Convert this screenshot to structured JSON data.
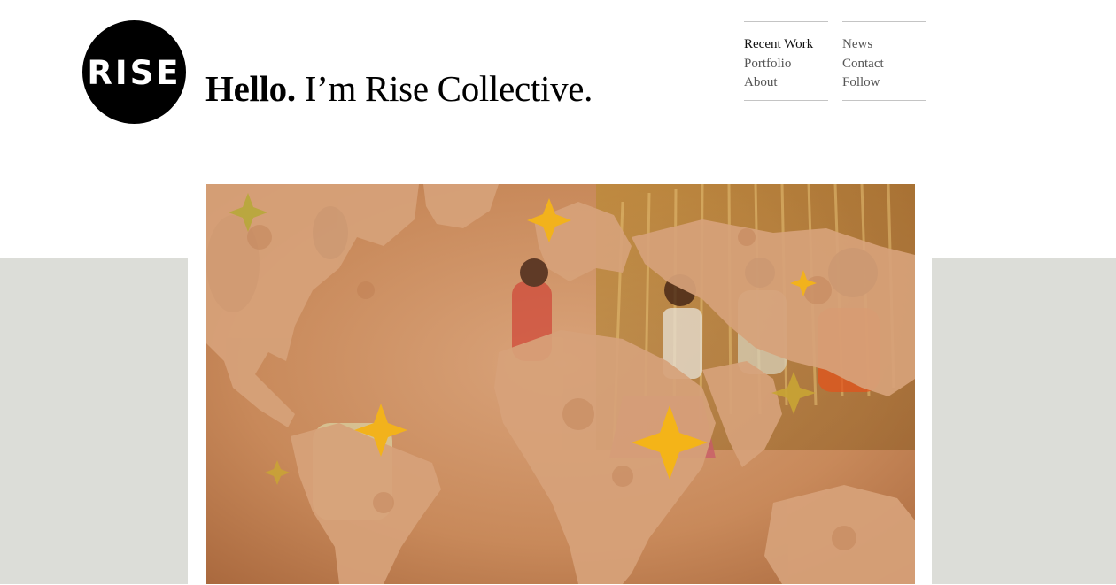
{
  "brand": {
    "logo_text": "RISE"
  },
  "header": {
    "greeting": "Hello.",
    "tagline": "I’m Rise Collective."
  },
  "nav": {
    "left": [
      {
        "label": "Recent Work",
        "active": true
      },
      {
        "label": "Portfolio",
        "active": false
      },
      {
        "label": "About",
        "active": false
      }
    ],
    "right": [
      {
        "label": "News",
        "active": false
      },
      {
        "label": "Contact",
        "active": false
      },
      {
        "label": "Follow",
        "active": false
      }
    ]
  },
  "colors": {
    "band_grey": "#dcddd8",
    "hero_tone": "#c58a5c",
    "star_gold": "#f2b21c"
  },
  "hero": {
    "icon": "world-map-stars-image"
  }
}
